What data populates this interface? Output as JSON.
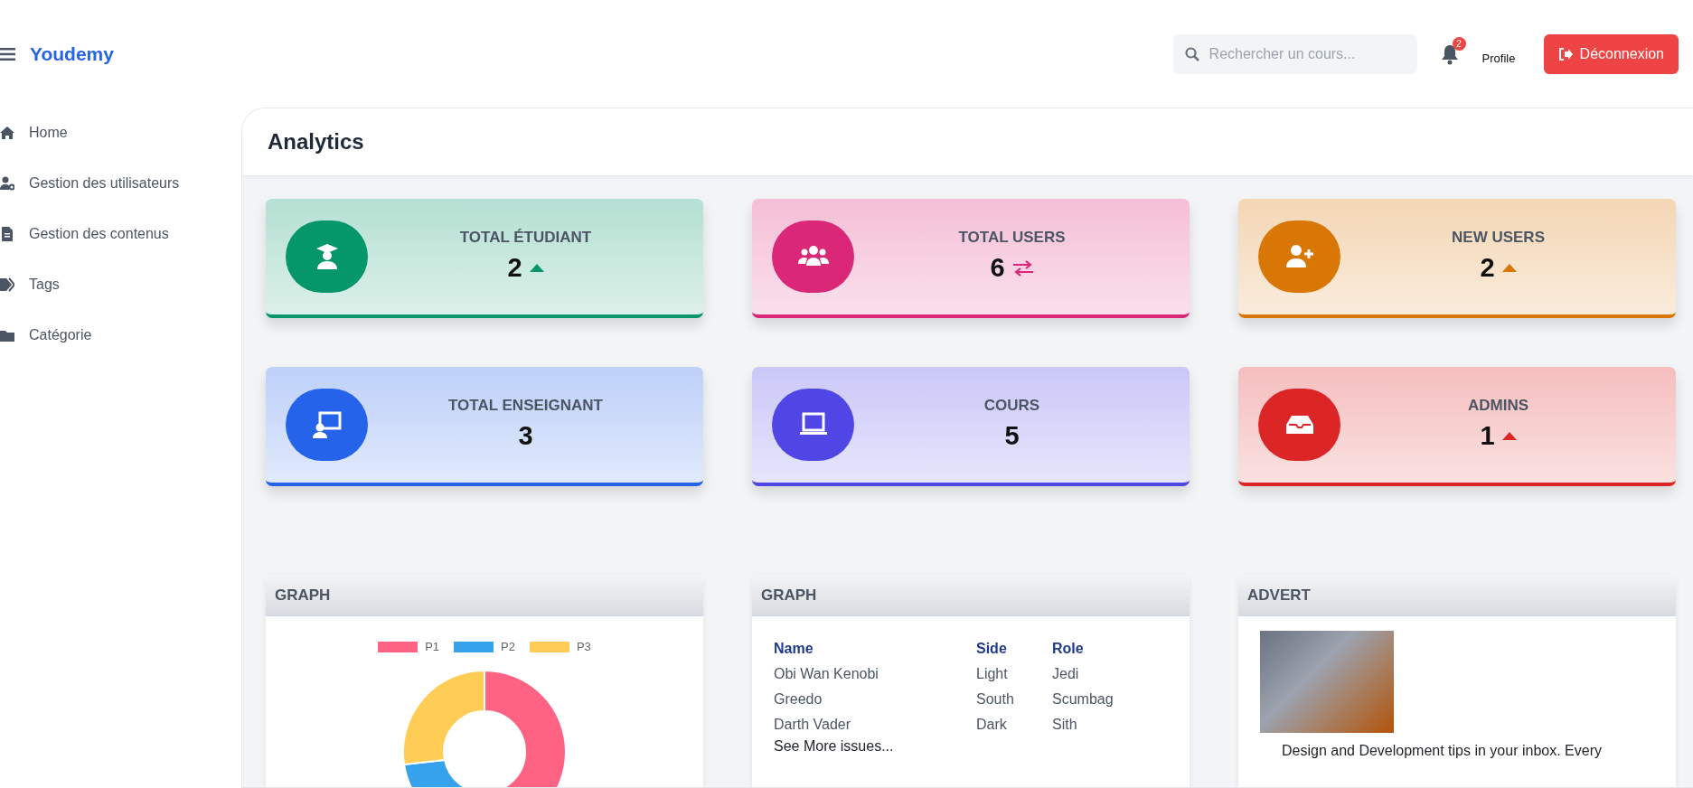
{
  "brand": "Youdemy",
  "search": {
    "placeholder": "Rechercher un cours..."
  },
  "notifications": {
    "count": "2"
  },
  "profile": {
    "alt": "Profile"
  },
  "logout": {
    "label": "Déconnexion"
  },
  "sidebar": {
    "items": [
      {
        "label": "Home"
      },
      {
        "label": "Gestion des utilisateurs"
      },
      {
        "label": "Gestion des contenus"
      },
      {
        "label": "Tags"
      },
      {
        "label": "Catégorie"
      }
    ]
  },
  "page_title": "Analytics",
  "stats": [
    {
      "kind": "rising",
      "label": "TOTAL ÉTUDIANT",
      "value": "2",
      "color": "#059669"
    },
    {
      "kind": "swap",
      "label": "TOTAL USERS",
      "value": "6",
      "color": "#db2777"
    },
    {
      "kind": "rising",
      "label": "NEW USERS",
      "value": "2",
      "color": "#d97706"
    },
    {
      "kind": "plain",
      "label": "TOTAL ENSEIGNANT",
      "value": "3",
      "color": "#2563eb"
    },
    {
      "kind": "plain",
      "label": "COURS",
      "value": "5",
      "color": "#4f46e5"
    },
    {
      "kind": "rising",
      "label": "ADMINS",
      "value": "1",
      "color": "#dc2626"
    }
  ],
  "panels": [
    {
      "kind": "donut",
      "title": "GRAPH",
      "legend": [
        {
          "label": "P1",
          "color": "#ff6384"
        },
        {
          "label": "P2",
          "color": "#36a2eb"
        },
        {
          "label": "P3",
          "color": "#ffcd56"
        }
      ]
    },
    {
      "kind": "table",
      "title": "GRAPH",
      "columns": [
        "Name",
        "Side",
        "Role"
      ],
      "rows": [
        [
          "Obi Wan Kenobi",
          "Light",
          "Jedi"
        ],
        [
          "Greedo",
          "South",
          "Scumbag"
        ],
        [
          "Darth Vader",
          "Dark",
          "Sith"
        ]
      ],
      "link": "See More issues..."
    },
    {
      "kind": "advert",
      "title": "ADVERT",
      "text": "Design and Development tips in your inbox. Every"
    }
  ]
}
